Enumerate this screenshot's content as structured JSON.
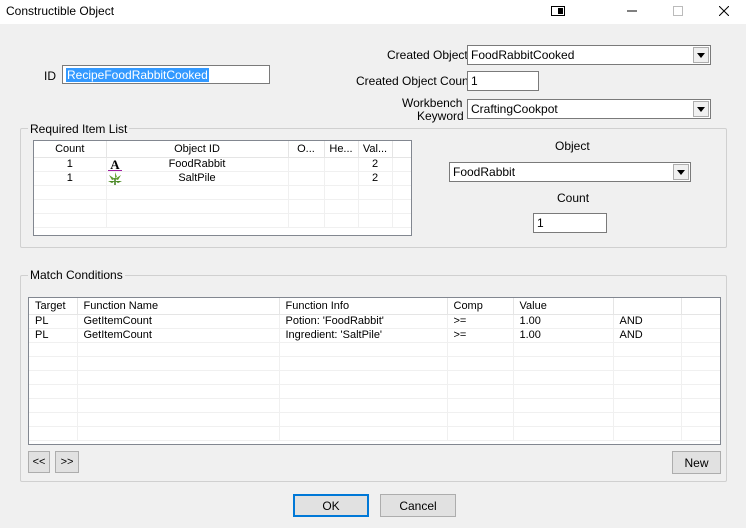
{
  "window": {
    "title": "Constructible Object",
    "icon_buttons": [
      "restore-icon",
      "minimize-icon",
      "maximize-icon",
      "close-icon"
    ]
  },
  "form": {
    "id_label": "ID",
    "id_value": "RecipeFoodRabbitCooked",
    "created_object_label": "Created Object",
    "created_object_value": "FoodRabbitCooked",
    "created_object_count_label": "Created Object Count",
    "created_object_count_value": "1",
    "workbench_label_line1": "Workbench",
    "workbench_label_line2": "Keyword",
    "workbench_value": "CraftingCookpot"
  },
  "required_items": {
    "group_label": "Required Item List",
    "columns": [
      "Count",
      "Object ID",
      "O...",
      "He...",
      "Val..."
    ],
    "rows": [
      {
        "count": "1",
        "icon": "letter-a-icon",
        "object_id": "FoodRabbit",
        "o": "",
        "he": "",
        "val": "2"
      },
      {
        "count": "1",
        "icon": "plant-icon",
        "object_id": "SaltPile",
        "o": "",
        "he": "",
        "val": "2"
      }
    ],
    "object_label": "Object",
    "object_value": "FoodRabbit",
    "count_label": "Count",
    "count_value": "1"
  },
  "match_conditions": {
    "group_label": "Match Conditions",
    "columns": [
      "Target",
      "Function Name",
      "Function Info",
      "Comp",
      "Value",
      ""
    ],
    "rows": [
      {
        "target": "PL",
        "function_name": "GetItemCount",
        "function_info": "Potion: 'FoodRabbit'",
        "comp": ">=",
        "value": "1.00",
        "op": "AND"
      },
      {
        "target": "PL",
        "function_name": "GetItemCount",
        "function_info": "Ingredient: 'SaltPile'",
        "comp": ">=",
        "value": "1.00",
        "op": "AND"
      }
    ],
    "prev_label": "<<",
    "next_label": ">>",
    "new_label": "New"
  },
  "footer": {
    "ok_label": "OK",
    "cancel_label": "Cancel"
  },
  "colors": {
    "selection": "#3399ff",
    "focus_border": "#0078d7",
    "window_bg": "#f0f0f0"
  }
}
